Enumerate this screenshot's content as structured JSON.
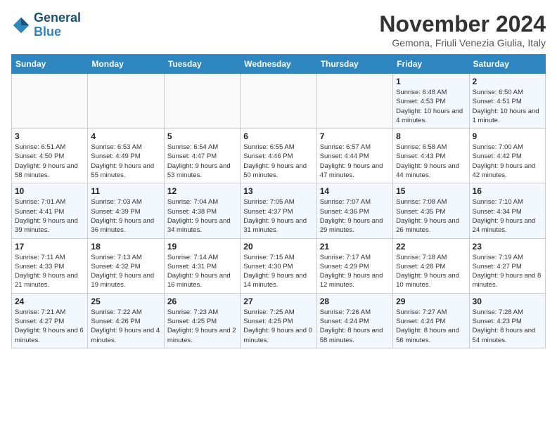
{
  "header": {
    "logo_line1": "General",
    "logo_line2": "Blue",
    "title": "November 2024",
    "subtitle": "Gemona, Friuli Venezia Giulia, Italy"
  },
  "days_of_week": [
    "Sunday",
    "Monday",
    "Tuesday",
    "Wednesday",
    "Thursday",
    "Friday",
    "Saturday"
  ],
  "weeks": [
    [
      {
        "day": "",
        "detail": ""
      },
      {
        "day": "",
        "detail": ""
      },
      {
        "day": "",
        "detail": ""
      },
      {
        "day": "",
        "detail": ""
      },
      {
        "day": "",
        "detail": ""
      },
      {
        "day": "1",
        "detail": "Sunrise: 6:48 AM\nSunset: 4:53 PM\nDaylight: 10 hours\nand 4 minutes."
      },
      {
        "day": "2",
        "detail": "Sunrise: 6:50 AM\nSunset: 4:51 PM\nDaylight: 10 hours\nand 1 minute."
      }
    ],
    [
      {
        "day": "3",
        "detail": "Sunrise: 6:51 AM\nSunset: 4:50 PM\nDaylight: 9 hours\nand 58 minutes."
      },
      {
        "day": "4",
        "detail": "Sunrise: 6:53 AM\nSunset: 4:49 PM\nDaylight: 9 hours\nand 55 minutes."
      },
      {
        "day": "5",
        "detail": "Sunrise: 6:54 AM\nSunset: 4:47 PM\nDaylight: 9 hours\nand 53 minutes."
      },
      {
        "day": "6",
        "detail": "Sunrise: 6:55 AM\nSunset: 4:46 PM\nDaylight: 9 hours\nand 50 minutes."
      },
      {
        "day": "7",
        "detail": "Sunrise: 6:57 AM\nSunset: 4:44 PM\nDaylight: 9 hours\nand 47 minutes."
      },
      {
        "day": "8",
        "detail": "Sunrise: 6:58 AM\nSunset: 4:43 PM\nDaylight: 9 hours\nand 44 minutes."
      },
      {
        "day": "9",
        "detail": "Sunrise: 7:00 AM\nSunset: 4:42 PM\nDaylight: 9 hours\nand 42 minutes."
      }
    ],
    [
      {
        "day": "10",
        "detail": "Sunrise: 7:01 AM\nSunset: 4:41 PM\nDaylight: 9 hours\nand 39 minutes."
      },
      {
        "day": "11",
        "detail": "Sunrise: 7:03 AM\nSunset: 4:39 PM\nDaylight: 9 hours\nand 36 minutes."
      },
      {
        "day": "12",
        "detail": "Sunrise: 7:04 AM\nSunset: 4:38 PM\nDaylight: 9 hours\nand 34 minutes."
      },
      {
        "day": "13",
        "detail": "Sunrise: 7:05 AM\nSunset: 4:37 PM\nDaylight: 9 hours\nand 31 minutes."
      },
      {
        "day": "14",
        "detail": "Sunrise: 7:07 AM\nSunset: 4:36 PM\nDaylight: 9 hours\nand 29 minutes."
      },
      {
        "day": "15",
        "detail": "Sunrise: 7:08 AM\nSunset: 4:35 PM\nDaylight: 9 hours\nand 26 minutes."
      },
      {
        "day": "16",
        "detail": "Sunrise: 7:10 AM\nSunset: 4:34 PM\nDaylight: 9 hours\nand 24 minutes."
      }
    ],
    [
      {
        "day": "17",
        "detail": "Sunrise: 7:11 AM\nSunset: 4:33 PM\nDaylight: 9 hours\nand 21 minutes."
      },
      {
        "day": "18",
        "detail": "Sunrise: 7:13 AM\nSunset: 4:32 PM\nDaylight: 9 hours\nand 19 minutes."
      },
      {
        "day": "19",
        "detail": "Sunrise: 7:14 AM\nSunset: 4:31 PM\nDaylight: 9 hours\nand 16 minutes."
      },
      {
        "day": "20",
        "detail": "Sunrise: 7:15 AM\nSunset: 4:30 PM\nDaylight: 9 hours\nand 14 minutes."
      },
      {
        "day": "21",
        "detail": "Sunrise: 7:17 AM\nSunset: 4:29 PM\nDaylight: 9 hours\nand 12 minutes."
      },
      {
        "day": "22",
        "detail": "Sunrise: 7:18 AM\nSunset: 4:28 PM\nDaylight: 9 hours\nand 10 minutes."
      },
      {
        "day": "23",
        "detail": "Sunrise: 7:19 AM\nSunset: 4:27 PM\nDaylight: 9 hours\nand 8 minutes."
      }
    ],
    [
      {
        "day": "24",
        "detail": "Sunrise: 7:21 AM\nSunset: 4:27 PM\nDaylight: 9 hours\nand 6 minutes."
      },
      {
        "day": "25",
        "detail": "Sunrise: 7:22 AM\nSunset: 4:26 PM\nDaylight: 9 hours\nand 4 minutes."
      },
      {
        "day": "26",
        "detail": "Sunrise: 7:23 AM\nSunset: 4:25 PM\nDaylight: 9 hours\nand 2 minutes."
      },
      {
        "day": "27",
        "detail": "Sunrise: 7:25 AM\nSunset: 4:25 PM\nDaylight: 9 hours\nand 0 minutes."
      },
      {
        "day": "28",
        "detail": "Sunrise: 7:26 AM\nSunset: 4:24 PM\nDaylight: 8 hours\nand 58 minutes."
      },
      {
        "day": "29",
        "detail": "Sunrise: 7:27 AM\nSunset: 4:24 PM\nDaylight: 8 hours\nand 56 minutes."
      },
      {
        "day": "30",
        "detail": "Sunrise: 7:28 AM\nSunset: 4:23 PM\nDaylight: 8 hours\nand 54 minutes."
      }
    ]
  ]
}
